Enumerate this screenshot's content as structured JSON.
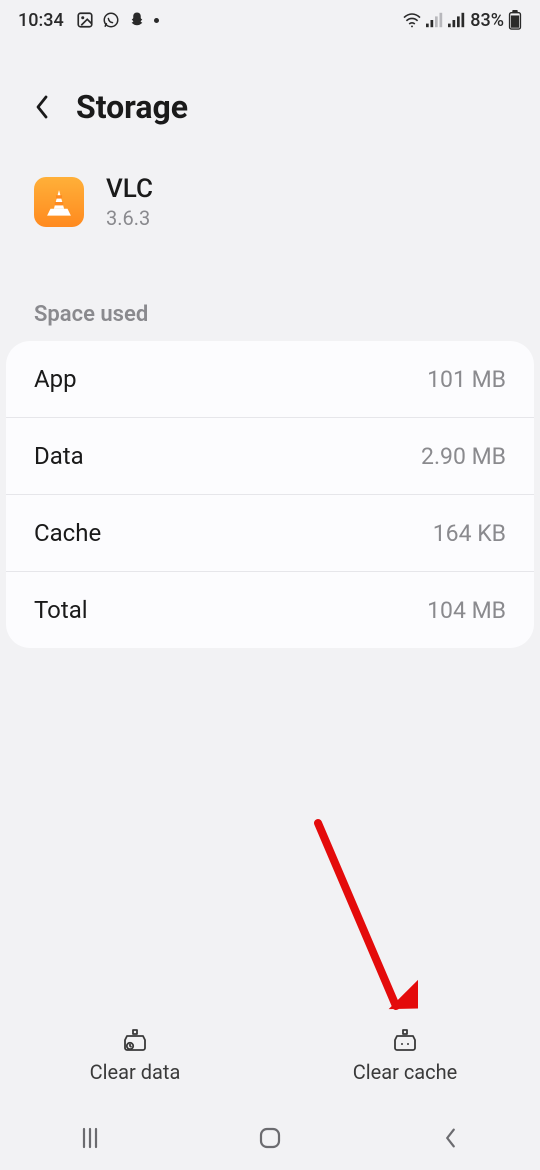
{
  "status": {
    "time": "10:34",
    "battery_pct": "83%"
  },
  "header": {
    "title": "Storage"
  },
  "app": {
    "name": "VLC",
    "version": "3.6.3"
  },
  "section": {
    "space_used": "Space used"
  },
  "rows": {
    "app_label": "App",
    "app_value": "101 MB",
    "data_label": "Data",
    "data_value": "2.90 MB",
    "cache_label": "Cache",
    "cache_value": "164 KB",
    "total_label": "Total",
    "total_value": "104 MB"
  },
  "actions": {
    "clear_data": "Clear data",
    "clear_cache": "Clear cache"
  }
}
